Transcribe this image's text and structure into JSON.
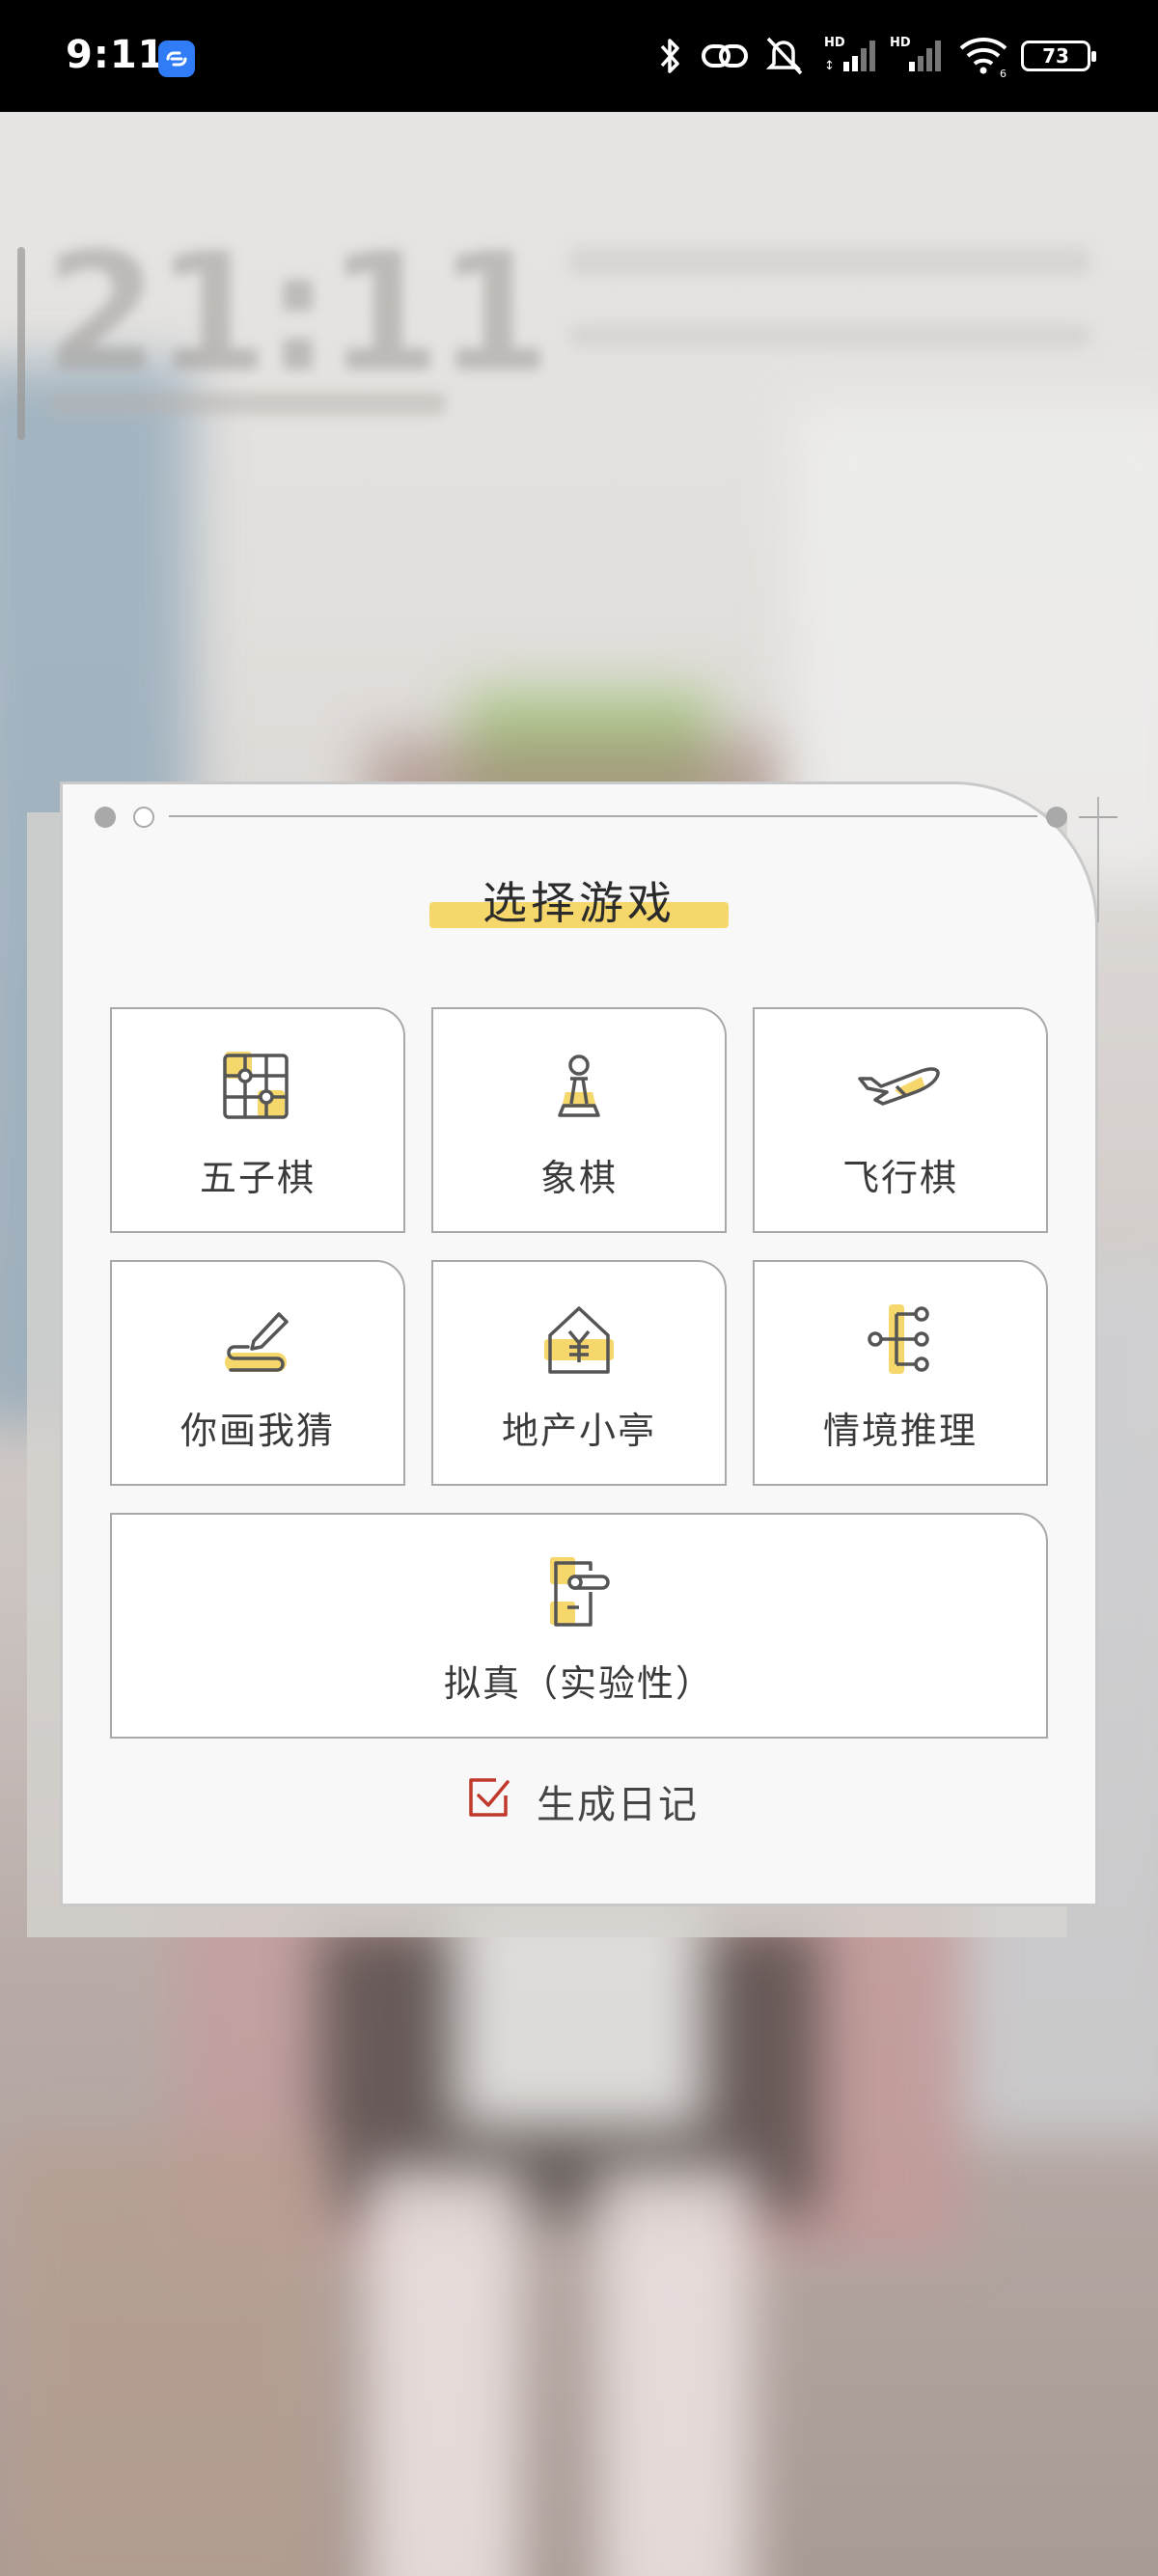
{
  "status_bar": {
    "time": "9:11",
    "battery": "73",
    "icons": [
      "app-link-icon",
      "bluetooth-icon",
      "link-icon",
      "mute-icon",
      "signal-hd-icon",
      "signal-hd-icon",
      "wifi-icon",
      "battery-icon"
    ]
  },
  "background": {
    "clock": "21:11"
  },
  "dialog": {
    "title": "选择游戏",
    "games": [
      {
        "label": "五子棋",
        "icon": "grid-board-icon"
      },
      {
        "label": "象棋",
        "icon": "chess-pawn-icon"
      },
      {
        "label": "飞行棋",
        "icon": "airplane-icon"
      },
      {
        "label": "你画我猜",
        "icon": "pencil-draw-icon"
      },
      {
        "label": "地产小亭",
        "icon": "house-yen-icon"
      },
      {
        "label": "情境推理",
        "icon": "flow-tree-icon"
      },
      {
        "label": "拟真（实验性）",
        "icon": "door-icon"
      }
    ],
    "diary": {
      "label": "生成日记",
      "checked": true
    }
  },
  "colors": {
    "accent_yellow": "#f6d76b",
    "check_red": "#c0392b",
    "tile_border": "#a9a9a9"
  }
}
